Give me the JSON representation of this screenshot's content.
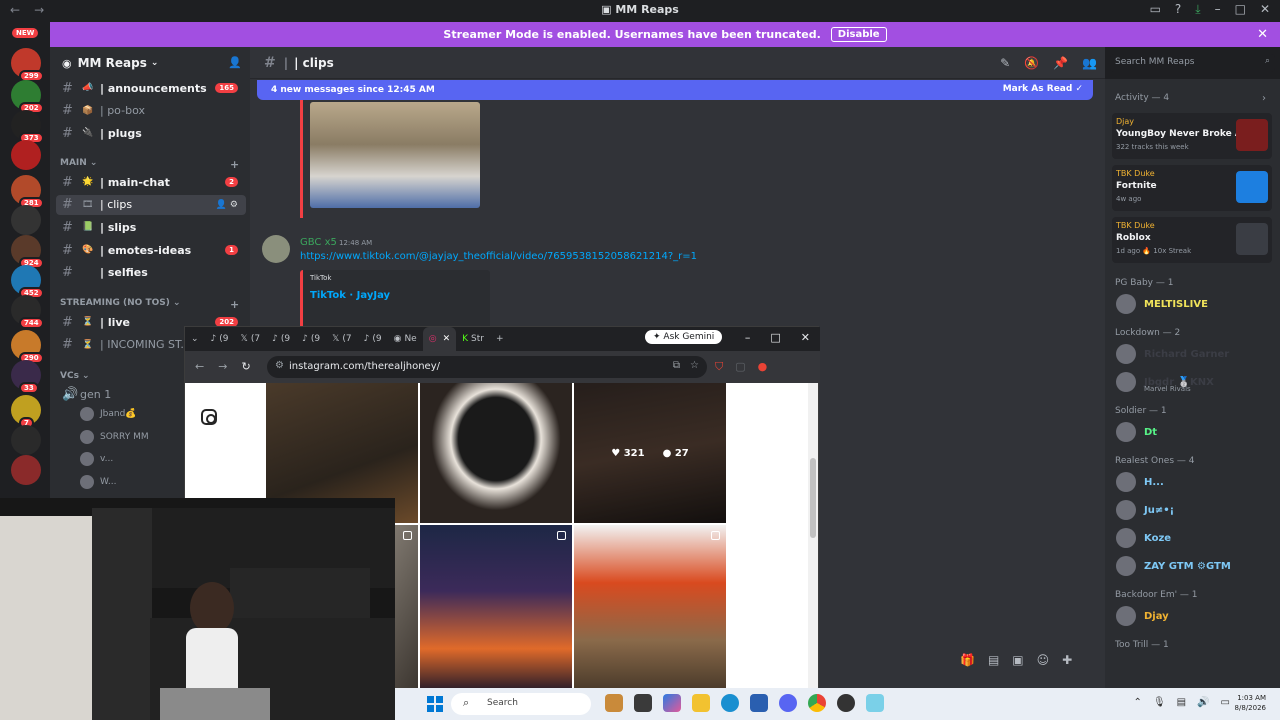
{
  "window": {
    "title": "MM Reaps"
  },
  "banner": {
    "text": "Streamer Mode is enabled. Usernames have been truncated.",
    "button": "Disable"
  },
  "servers": {
    "new_tag": "NEW",
    "badges": [
      "299",
      "202",
      "373",
      "281",
      "924",
      "452",
      "744",
      "290",
      "33",
      "7"
    ]
  },
  "guild": {
    "name": "MM Reaps"
  },
  "channels": {
    "top": [
      {
        "name": "| announcements",
        "emoji": "📣",
        "count": "165",
        "unread": true
      },
      {
        "name": "| po-box",
        "emoji": "📦",
        "count": "",
        "unread": false
      },
      {
        "name": "| plugs",
        "emoji": "🔌",
        "count": "",
        "unread": true
      }
    ],
    "main_label": "MAIN",
    "main": [
      {
        "name": "| main-chat",
        "emoji": "🌟",
        "count": "2",
        "unread": true
      },
      {
        "name": "| clips",
        "emoji": "🎞",
        "count": "",
        "unread": false,
        "active": true
      },
      {
        "name": "| slips",
        "emoji": "📗",
        "count": "",
        "unread": true
      },
      {
        "name": "| emotes-ideas",
        "emoji": "🎨",
        "count": "1",
        "unread": true
      },
      {
        "name": "| selfies",
        "emoji": "",
        "count": "",
        "unread": true
      }
    ],
    "streaming_label": "STREAMING (NO TOS)",
    "streaming": [
      {
        "name": "| live",
        "emoji": "⏳",
        "count": "202",
        "unread": true
      },
      {
        "name": "| INCOMING ST...",
        "emoji": "⏳",
        "count": "",
        "unread": false
      }
    ],
    "vcs_label": "VCs",
    "voice": {
      "name": "gen 1",
      "users": [
        "Jband💰",
        "SORRY MM",
        "v...",
        "W..."
      ]
    }
  },
  "chat": {
    "channel_title": "| clips",
    "new_messages": "4 new messages since 12:45 AM",
    "mark_read": "Mark As Read",
    "message": {
      "author": "GBC x5",
      "time": "12:48 AM",
      "link": "https://www.tiktok.com/@jayjay_theofficial/video/7659538152058621214?_r=1",
      "embed_provider": "TikTok",
      "embed_title": "TikTok · JayJay"
    }
  },
  "search": {
    "placeholder": "Search MM Reaps"
  },
  "members": {
    "activity_label": "Activity — 4",
    "activities": [
      {
        "user": "Djay",
        "title": "YoungBoy Never Broke Again",
        "meta": "322 tracks this week",
        "color": "#7a1e1e"
      },
      {
        "user": "TBK Duke",
        "title": "Fortnite",
        "meta": "4w ago",
        "color": "#1d7fe0"
      },
      {
        "user": "TBK Duke",
        "title": "Roblox",
        "meta": "1d ago  🔥 10x Streak",
        "color": "#3a3d44"
      }
    ],
    "groups": [
      {
        "label": "PG Baby — 1",
        "members": [
          {
            "name": "MELTISLIVE",
            "color": "#f0e35a",
            "sub": ""
          }
        ]
      },
      {
        "label": "Lockdown — 2",
        "members": [
          {
            "name": "Richard Garner",
            "color": "#3b3d45",
            "sub": ""
          },
          {
            "name": "Jbgdr 🥈KNX",
            "color": "#3b3d45",
            "sub": "Marvel Rivals"
          }
        ]
      },
      {
        "label": "Soldier — 1",
        "members": [
          {
            "name": "Dt",
            "color": "#57f287",
            "sub": ""
          }
        ]
      },
      {
        "label": "Realest Ones — 4",
        "members": [
          {
            "name": "H...",
            "color": "#7ec8f5",
            "sub": ""
          },
          {
            "name": "Ju≠•¡",
            "color": "#7ec8f5",
            "sub": ""
          },
          {
            "name": "Koze",
            "color": "#7ec8f5",
            "sub": ""
          },
          {
            "name": "ZAY GTM ⚙GTM",
            "color": "#7ec8f5",
            "sub": ""
          }
        ]
      },
      {
        "label": "Backdoor Em' — 1",
        "members": [
          {
            "name": "Djay",
            "color": "#f0b232",
            "sub": ""
          }
        ]
      },
      {
        "label": "Too Trill — 1",
        "members": []
      }
    ]
  },
  "browser": {
    "tabs": [
      "(9",
      "(7",
      "(9",
      "(9",
      "(7",
      "(9",
      "Ne",
      "",
      "Str"
    ],
    "ask_gemini": "Ask Gemini",
    "url": "instagram.com/therealjhoney/",
    "hover_likes": "321",
    "hover_comments": "27"
  },
  "taskbar": {
    "search": "Search",
    "time": "1:03 AM",
    "date": "8/8/2026"
  },
  "colors": {
    "discord_bg": "#313338",
    "sidebar": "#2b2d31",
    "blurple": "#5865f2",
    "streamer": "#a24fe1"
  }
}
